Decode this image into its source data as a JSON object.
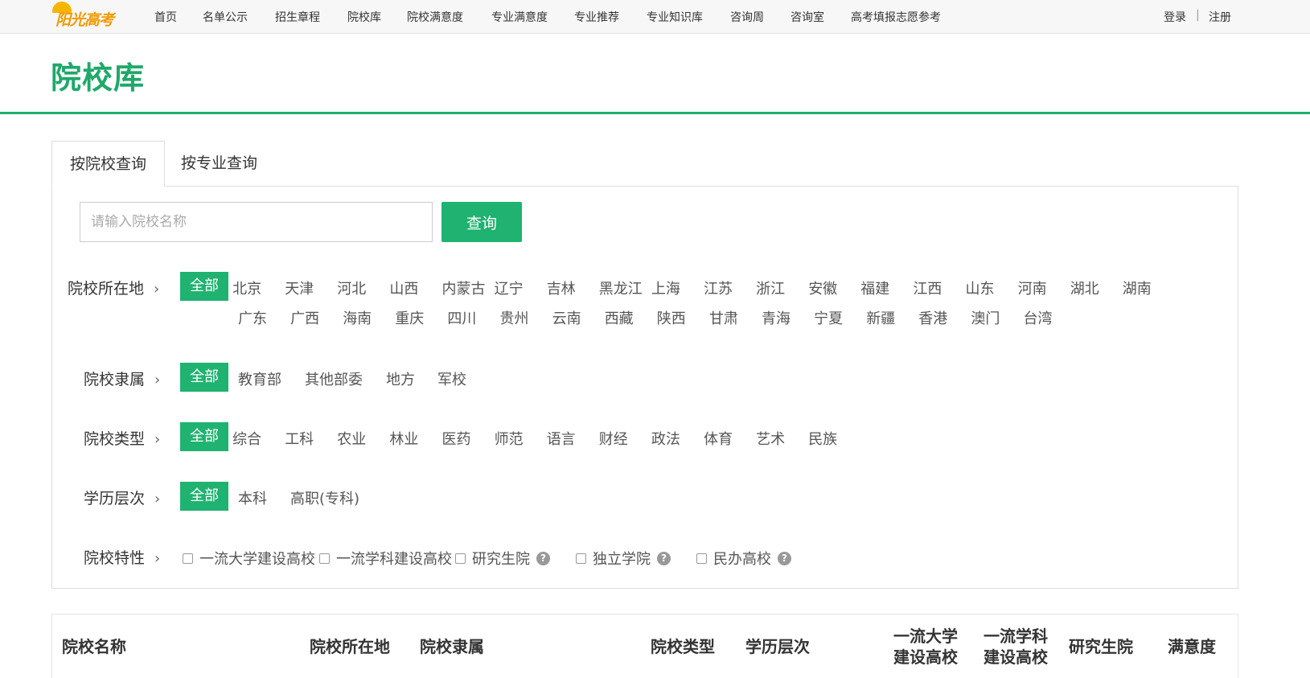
{
  "logo": {
    "text": "阳光高考"
  },
  "nav": [
    "首页",
    "名单公示",
    "招生章程",
    "院校库",
    "院校满意度",
    "专业满意度",
    "专业推荐",
    "专业知识库",
    "咨询周",
    "咨询室",
    "高考填报志愿参考"
  ],
  "auth": {
    "login": "登录",
    "separator": "|",
    "register": "注册"
  },
  "page": {
    "title": "院校库"
  },
  "tabs": {
    "active": "按院校查询",
    "other": "按专业查询"
  },
  "search": {
    "placeholder": "请输入院校名称",
    "button": "查询"
  },
  "filters": {
    "location": {
      "label": "院校所在地",
      "options_row1": [
        "全部",
        "北京",
        "天津",
        "河北",
        "山西",
        "内蒙古",
        "辽宁",
        "吉林",
        "黑龙江",
        "上海",
        "江苏",
        "浙江",
        "安徽",
        "福建",
        "江西",
        "山东",
        "河南",
        "湖北",
        "湖南"
      ],
      "options_row2": [
        "广东",
        "广西",
        "海南",
        "重庆",
        "四川",
        "贵州",
        "云南",
        "西藏",
        "陕西",
        "甘肃",
        "青海",
        "宁夏",
        "新疆",
        "香港",
        "澳门",
        "台湾"
      ]
    },
    "affiliation": {
      "label": "院校隶属",
      "options": [
        "全部",
        "教育部",
        "其他部委",
        "地方",
        "军校"
      ]
    },
    "type": {
      "label": "院校类型",
      "options": [
        "全部",
        "综合",
        "工科",
        "农业",
        "林业",
        "医药",
        "师范",
        "语言",
        "财经",
        "政法",
        "体育",
        "艺术",
        "民族"
      ]
    },
    "level": {
      "label": "学历层次",
      "options": [
        "全部",
        "本科",
        "高职(专科)"
      ]
    },
    "features": {
      "label": "院校特性",
      "options": [
        "一流大学建设高校",
        "一流学科建设高校",
        "研究生院",
        "独立学院",
        "民办高校"
      ]
    }
  },
  "table": {
    "headers": {
      "name": "院校名称",
      "location": "院校所在地",
      "affiliation": "院校隶属",
      "type": "院校类型",
      "level": "学历层次",
      "first_class_uni_1": "一流大学",
      "first_class_uni_2": "建设高校",
      "first_class_disc_1": "一流学科",
      "first_class_disc_2": "建设高校",
      "grad_school": "研究生院",
      "satisfaction": "满意度"
    }
  },
  "colors": {
    "accent": "#1fb270",
    "title": "#1fa86a",
    "logo": "#f29a00"
  }
}
